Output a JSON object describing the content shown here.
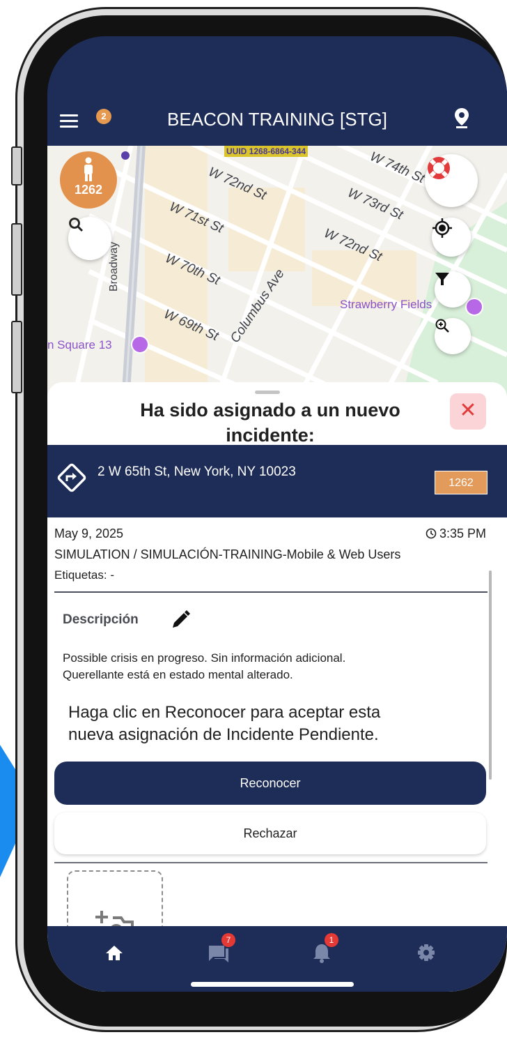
{
  "appbar": {
    "title": "BEACON TRAINING [STG]",
    "notification_count": "2"
  },
  "map": {
    "uuid_tag": "UUID 1268-6864-344",
    "unit_marker_label": "1262",
    "streets": [
      "W 72nd St",
      "W 74th St",
      "W 73rd St",
      "W 71st St",
      "W 72nd St",
      "W 70th St",
      "Columbus Ave",
      "W 69th St",
      "Broadway"
    ],
    "poi_labels": [
      "Strawberry Fields",
      "n Square 13"
    ]
  },
  "sheet": {
    "title_line1": "Ha sido asignado a un nuevo",
    "title_line2": "incidente:",
    "address": "2 W 65th St, New York, NY 10023",
    "unit_badge": "1262",
    "date": "May 9, 2025",
    "time": "3:35 PM",
    "incident_type": "SIMULATION / SIMULACIÓN-TRAINING-Mobile & Web Users",
    "tags": "Etiquetas: -",
    "description_heading": "Descripción",
    "description_line1": "Possible crisis en progreso. Sin información adicional.",
    "description_line2": "Querellante está en estado mental alterado.",
    "prompt_line1": "Haga clic en Reconocer para aceptar esta",
    "prompt_line2": "nueva asignación de Incidente Pendiente.",
    "acknowledge_label": "Reconocer",
    "reject_label": "Rechazar"
  },
  "bottom_nav": {
    "items": [
      {
        "icon": "home-icon"
      },
      {
        "icon": "chat-icon",
        "badge": "7"
      },
      {
        "icon": "bell-icon",
        "badge": "1"
      },
      {
        "icon": "gear-icon"
      }
    ]
  },
  "colors": {
    "navy": "#1e2d57",
    "orange": "#e69a4f",
    "badge_red": "#e53935",
    "accent_blue": "#1a8cf0"
  }
}
